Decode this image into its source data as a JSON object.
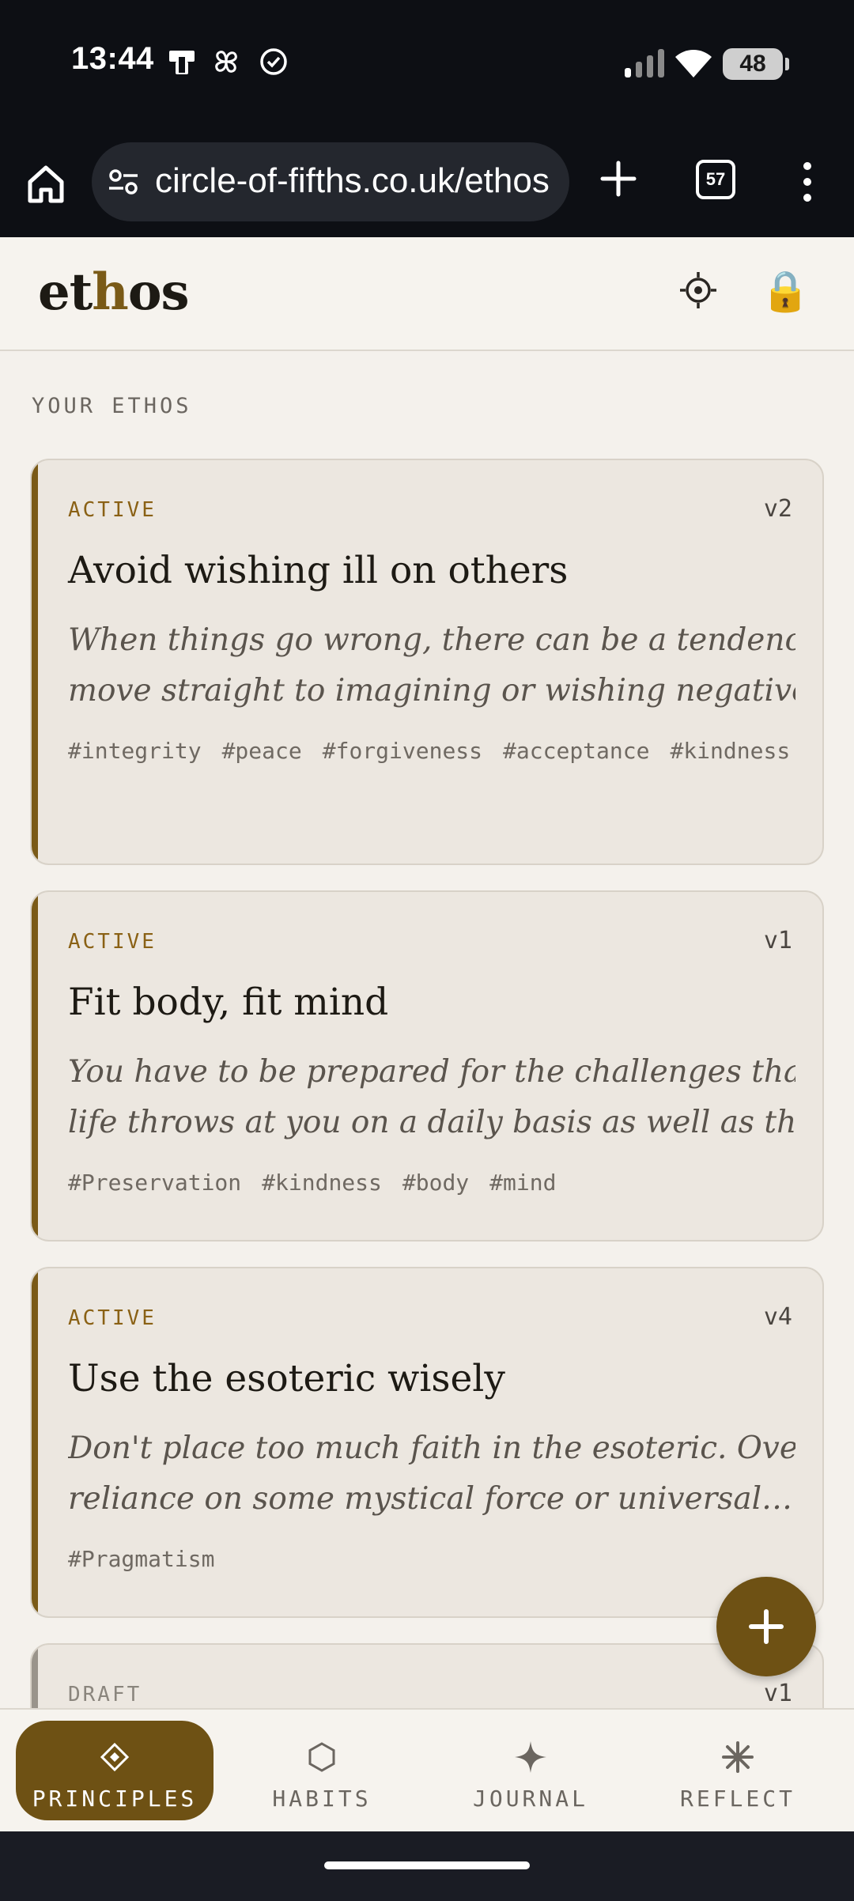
{
  "status_bar": {
    "time": "13:44",
    "battery": "48"
  },
  "browser": {
    "url": "circle-of-fifths.co.uk/ethos",
    "tab_count": "57"
  },
  "app": {
    "logo_pre": "et",
    "logo_accent": "h",
    "logo_post": "os",
    "lock_glyph": "🔒"
  },
  "section_label": "YOUR ETHOS",
  "cards": [
    {
      "status": "ACTIVE",
      "version": "v2",
      "title": "Avoid wishing ill on others",
      "desc_line1": "When things go wrong, there can be a tendency to",
      "desc_line2": "move straight to imagining or wishing negative…",
      "tags": [
        "#integrity",
        "#peace",
        "#forgiveness",
        "#acceptance",
        "#kindness"
      ]
    },
    {
      "status": "ACTIVE",
      "version": "v1",
      "title": "Fit body, fit mind",
      "desc_line1": "You have to be prepared for the challenges that",
      "desc_line2": "life throws at you on a daily basis as well as the…",
      "tags": [
        "#Preservation",
        "#kindness",
        "#body",
        "#mind"
      ]
    },
    {
      "status": "ACTIVE",
      "version": "v4",
      "title": "Use the esoteric wisely",
      "desc_line1": "Don't place too much faith in the esoteric. Over-",
      "desc_line2": "reliance on some mystical force or universal…",
      "tags": [
        "#Pragmatism"
      ]
    },
    {
      "status": "DRAFT",
      "version": "v1"
    }
  ],
  "nav": {
    "principles": "PRINCIPLES",
    "habits": "HABITS",
    "journal": "JOURNAL",
    "reflect": "REFLECT",
    "active": "principles"
  },
  "colors": {
    "accent": "#6e5114",
    "chrome": "#0d0f14",
    "background": "#f4f1ec",
    "card": "#ece7e0"
  }
}
